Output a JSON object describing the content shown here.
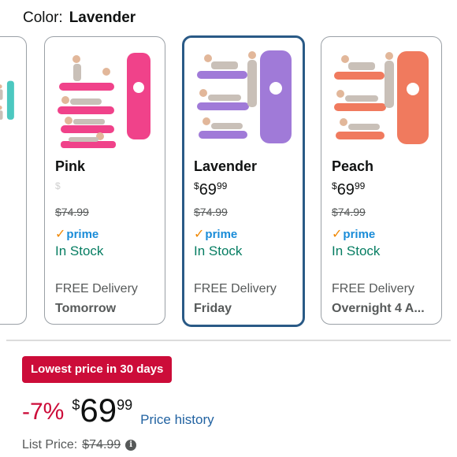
{
  "color_selector": {
    "label": "Color:",
    "value": "Lavender"
  },
  "variants": [
    {
      "name": "Pink",
      "price_currency": "",
      "price_whole": "$",
      "price_cents": "",
      "list_price": "$74.99",
      "prime_label": "prime",
      "stock": "In Stock",
      "delivery_label": "FREE Delivery",
      "delivery_day": "Tomorrow",
      "color": "#f0428a"
    },
    {
      "name": "Lavender",
      "price_currency": "$",
      "price_whole": "69",
      "price_cents": "99",
      "list_price": "$74.99",
      "prime_label": "prime",
      "stock": "In Stock",
      "delivery_label": "FREE Delivery",
      "delivery_day": "Friday",
      "color": "#a07ad8"
    },
    {
      "name": "Peach",
      "price_currency": "$",
      "price_whole": "69",
      "price_cents": "99",
      "list_price": "$74.99",
      "prime_label": "prime",
      "stock": "In Stock",
      "delivery_label": "FREE Delivery",
      "delivery_day": "Overnight 4 A...",
      "color": "#f07a5e"
    }
  ],
  "partial_variant_color": "#4cc8c0",
  "deal_badge": "Lowest price in 30 days",
  "price_block": {
    "discount": "-7%",
    "currency": "$",
    "whole": "69",
    "cents": "99",
    "history_link": "Price history"
  },
  "list_price": {
    "label": "List Price:",
    "value": "$74.99"
  },
  "colors": {
    "deal_red": "#cc0c39",
    "link_blue": "#2162a1",
    "stock_green": "#067D62",
    "selected_border": "#2a5a86"
  }
}
